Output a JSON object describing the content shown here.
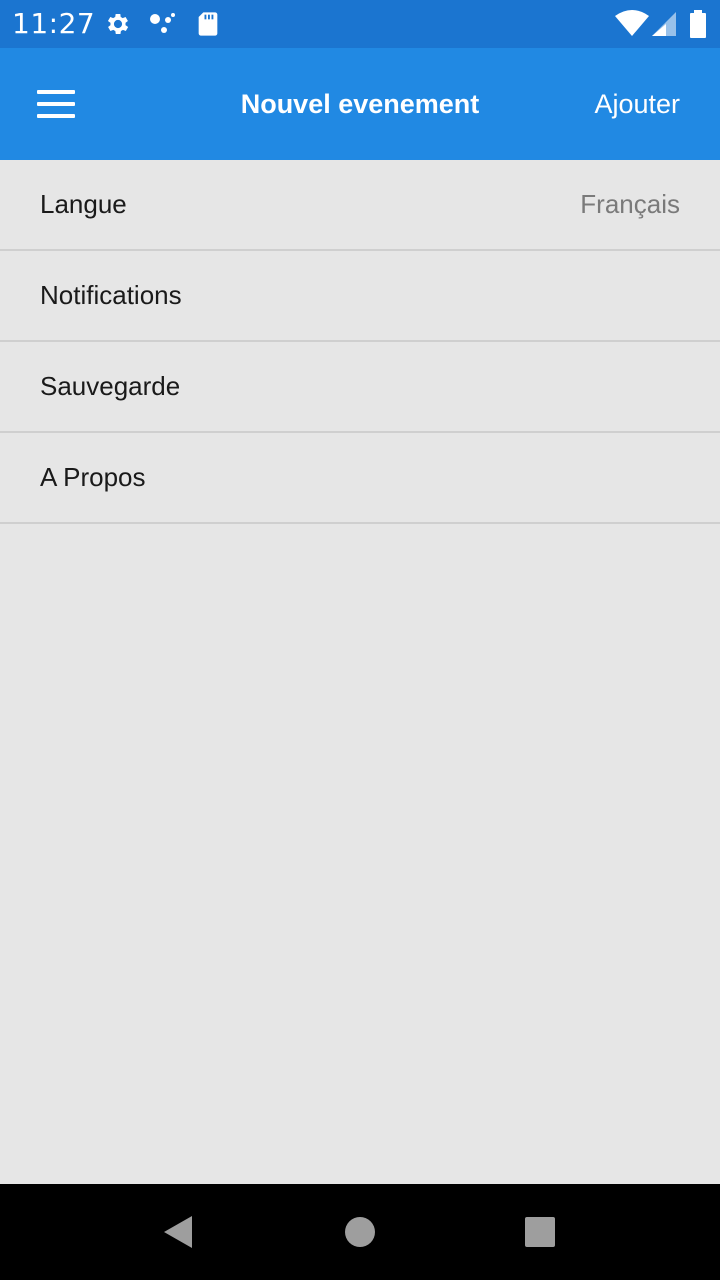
{
  "status_bar": {
    "time": "11:27",
    "left_icons": [
      "gear-icon",
      "dots-icon",
      "sd-card-icon"
    ],
    "right_icons": [
      "wifi-icon",
      "signal-icon",
      "battery-icon"
    ]
  },
  "app_bar": {
    "menu_icon": "hamburger-menu-icon",
    "title": "Nouvel evenement",
    "action_label": "Ajouter",
    "background_color": "#2189e3"
  },
  "settings": {
    "items": [
      {
        "label": "Langue",
        "value": "Français"
      },
      {
        "label": "Notifications"
      },
      {
        "label": "Sauvegarde"
      },
      {
        "label": "A Propos"
      }
    ]
  },
  "nav_bar": {
    "buttons": [
      "back-icon",
      "home-icon",
      "recents-icon"
    ]
  }
}
